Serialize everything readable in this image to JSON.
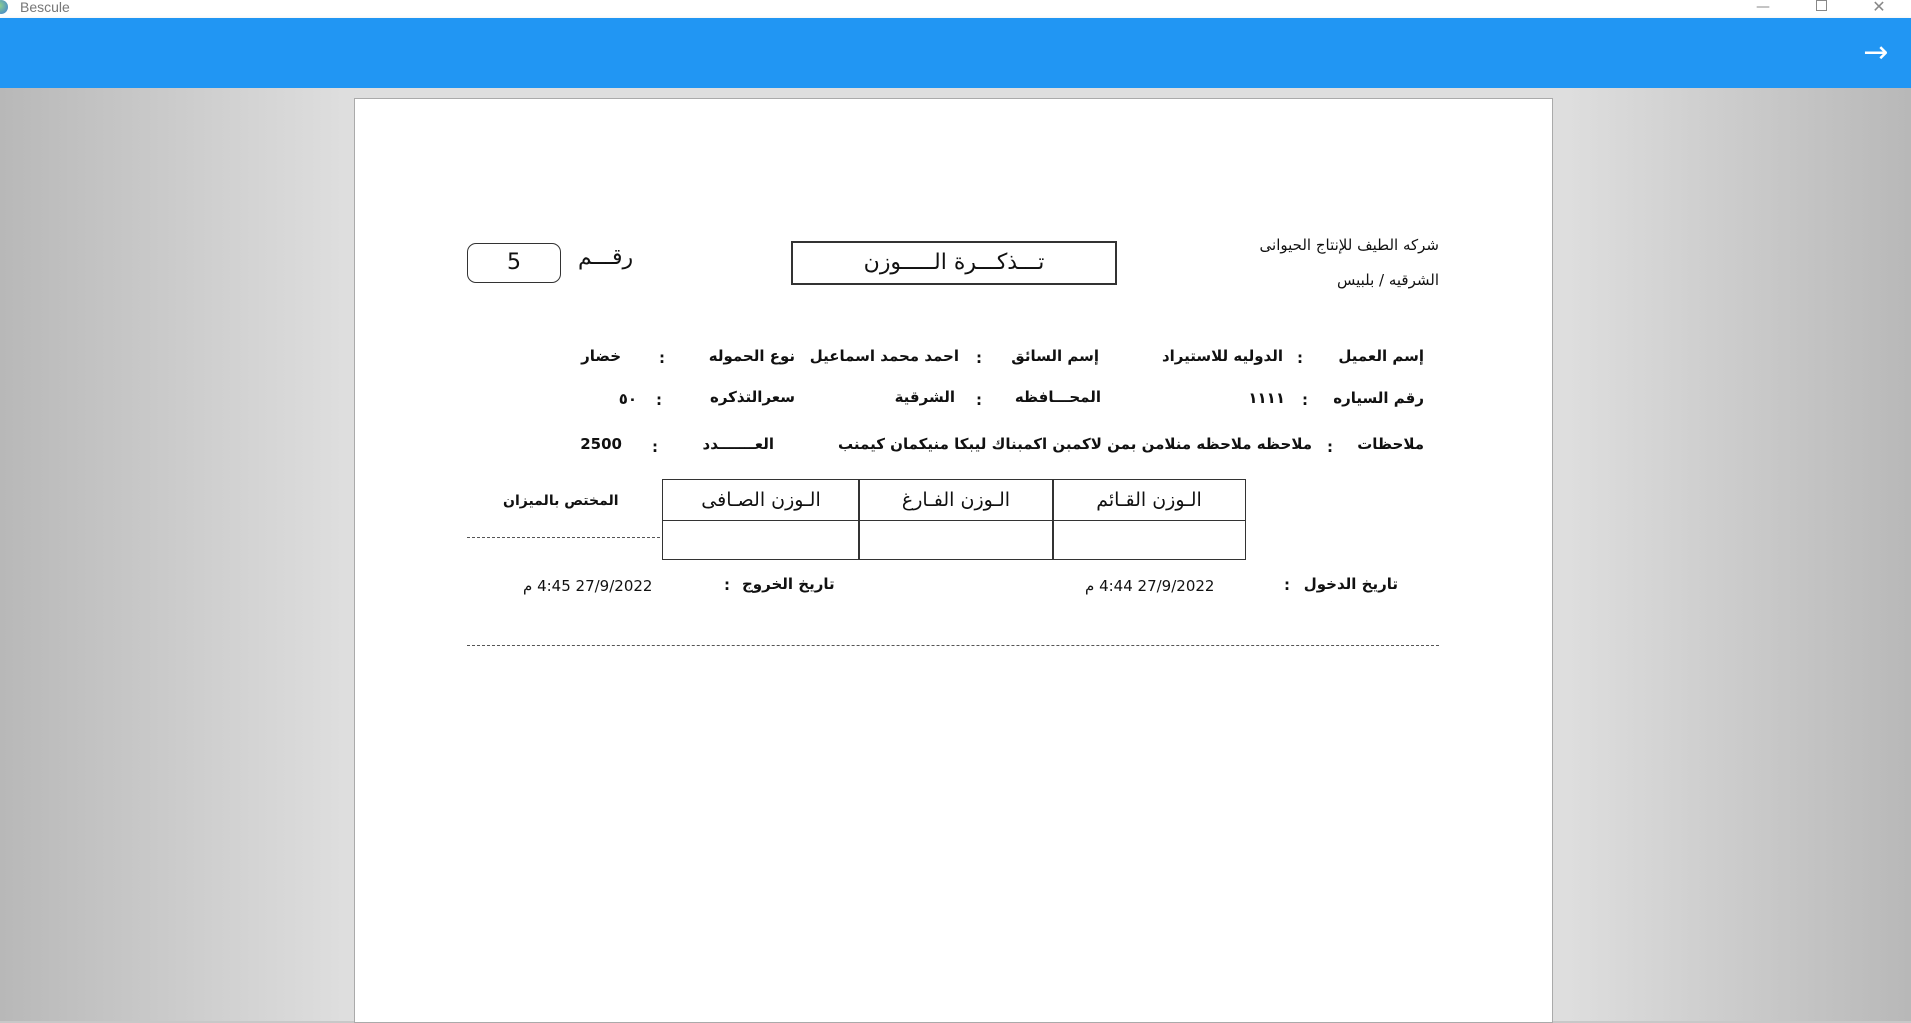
{
  "window": {
    "title": "Bescule"
  },
  "appbar": {
    "forward_icon": "→"
  },
  "ticket": {
    "company_name": "شركه الطيف للإنتاج الحيوانى",
    "company_location": "الشرقيه / بلبيس",
    "title": "تـــذكـــرة الـــــوزن",
    "number_label": "رقـــم",
    "number_value": "5",
    "customer_label": "إسم العميل",
    "customer_value": "الدوليه للاستيراد",
    "driver_label": "إسم السائق",
    "driver_value": "احمد محمد اسماعيل",
    "cargo_type_label": "نوع الحموله",
    "cargo_type_value": "خضار",
    "car_number_label": "رقم السياره",
    "car_number_value": "١١١١",
    "governorate_label": "المحـــافظه",
    "governorate_value": "الشرقية",
    "ticket_price_label": "سعرالتذكره",
    "ticket_price_value": "٥٠",
    "notes_label": "ملاحظات",
    "notes_value": "ملاحظه ملاحظه منلامن بمن لاكمبن اكمبناك ليبكا منيكمان كيمنب",
    "count_label": "العـــــــدد",
    "count_value": "2500",
    "colon": ":",
    "table": {
      "headers": [
        "الـوزن القـائم",
        "الـوزن الفـارغ",
        "الـوزن الصـافى"
      ],
      "values": [
        "",
        "",
        ""
      ]
    },
    "scale_officer_label": "المختص بالميزان",
    "entry_date_label": "تاريخ الدخول",
    "entry_date_value": "27/9/2022 4:44 م",
    "exit_date_label": "تاريخ الخروج",
    "exit_date_value": "27/9/2022 4:45 م"
  }
}
